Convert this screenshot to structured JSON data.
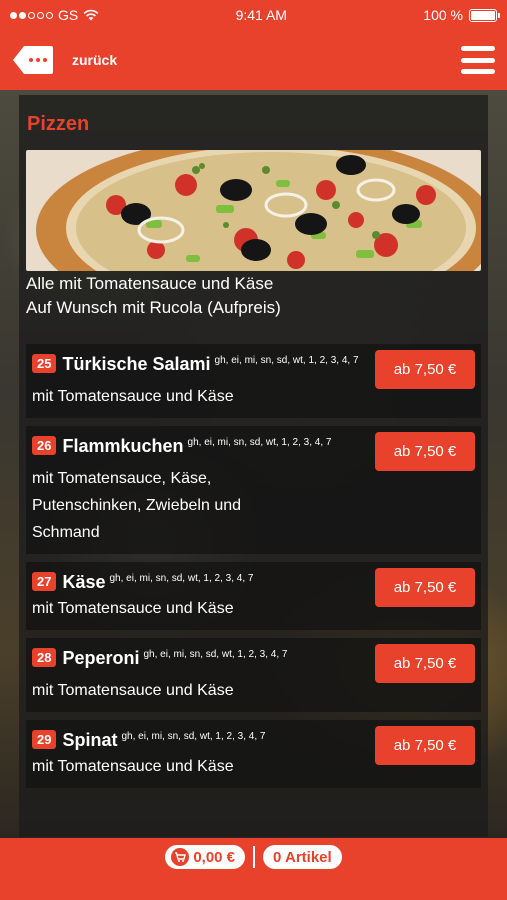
{
  "status_bar": {
    "carrier": "GS",
    "time": "9:41 AM",
    "battery": "100 %"
  },
  "header": {
    "back_label": "zurück"
  },
  "section": {
    "title": "Pizzen",
    "description_line1": "Alle mit Tomatensauce und Käse",
    "description_line2": "Auf Wunsch mit Rucola (Aufpreis)"
  },
  "items": [
    {
      "number": "25",
      "name": "Türkische Salami",
      "allergens": "gh, ei, mi, sn, sd, wt, 1, 2, 3, 4, 7",
      "description": "mit Tomatensauce und Käse",
      "price": "ab 7,50 €"
    },
    {
      "number": "26",
      "name": "Flammkuchen",
      "allergens": "gh, ei, mi, sn, sd, wt, 1, 2, 3, 4, 7",
      "description": "mit Tomatensauce, Käse, Putenschinken, Zwiebeln und Schmand",
      "price": "ab 7,50 €"
    },
    {
      "number": "27",
      "name": "Käse",
      "allergens": "gh, ei, mi, sn, sd, wt, 1, 2, 3, 4, 7",
      "description": "mit Tomatensauce und Käse",
      "price": "ab 7,50 €"
    },
    {
      "number": "28",
      "name": "Peperoni",
      "allergens": "gh, ei, mi, sn, sd, wt, 1, 2, 3, 4, 7",
      "description": "mit Tomatensauce und Käse",
      "price": "ab 7,50 €"
    },
    {
      "number": "29",
      "name": "Spinat",
      "allergens": "gh, ei, mi, sn, sd, wt, 1, 2, 3, 4, 7",
      "description": "mit Tomatensauce und Käse",
      "price": "ab 7,50 €"
    }
  ],
  "cart": {
    "total": "0,00 €",
    "articles": "0 Artikel"
  },
  "colors": {
    "accent": "#e8412c"
  }
}
